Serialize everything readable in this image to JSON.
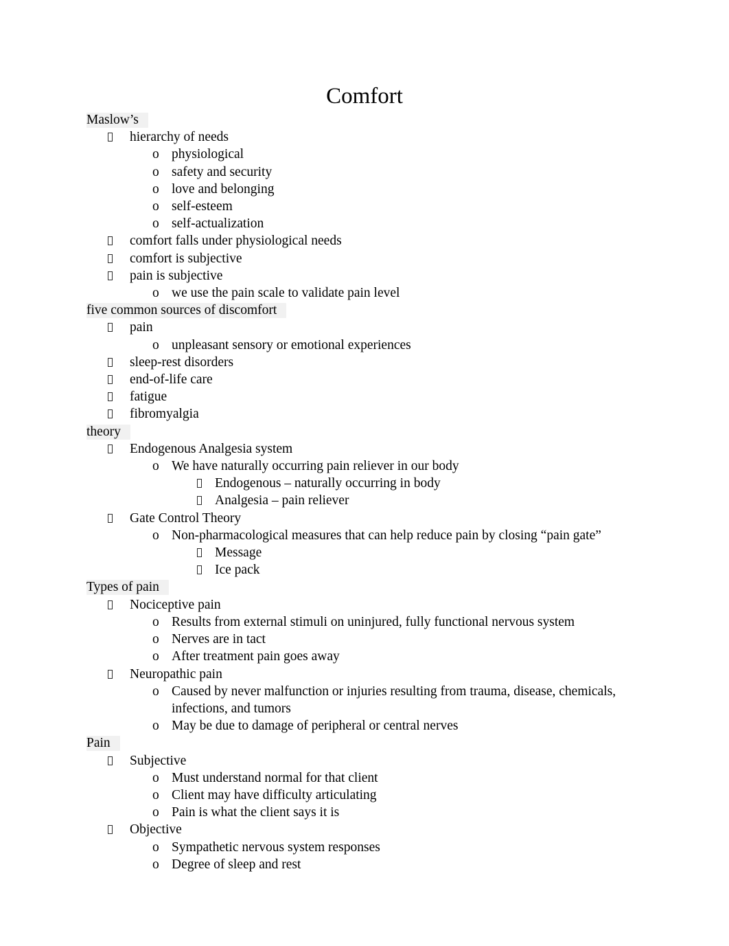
{
  "document": {
    "title": "Comfort",
    "page_background": "#ffffff",
    "text_color": "#000000",
    "heading_highlight_color": "#f1f1f1",
    "bullet_glyphs": {
      "level1": "missing-glyph-box",
      "level2": "o",
      "level3": "missing-glyph-box"
    }
  },
  "outline": [
    {
      "level": 0,
      "text": "Maslow’s",
      "shaded": true
    },
    {
      "level": 1,
      "text": "hierarchy of needs"
    },
    {
      "level": 2,
      "text": "physiological"
    },
    {
      "level": 2,
      "text": "safety and security"
    },
    {
      "level": 2,
      "text": "love and belonging"
    },
    {
      "level": 2,
      "text": "self-esteem"
    },
    {
      "level": 2,
      "text": "self-actualization"
    },
    {
      "level": 1,
      "text": "comfort falls under physiological needs"
    },
    {
      "level": 1,
      "text": "comfort is subjective"
    },
    {
      "level": 1,
      "text": "pain is subjective"
    },
    {
      "level": 2,
      "text": "we use the pain scale to validate pain level"
    },
    {
      "level": 0,
      "text": "five common sources of discomfort",
      "shaded": true
    },
    {
      "level": 1,
      "text": "pain"
    },
    {
      "level": 2,
      "text": "unpleasant sensory or emotional experiences"
    },
    {
      "level": 1,
      "text": "sleep-rest disorders"
    },
    {
      "level": 1,
      "text": "end-of-life care"
    },
    {
      "level": 1,
      "text": "fatigue"
    },
    {
      "level": 1,
      "text": "fibromyalgia"
    },
    {
      "level": 0,
      "text": "theory",
      "shaded": true
    },
    {
      "level": 1,
      "text": "Endogenous Analgesia system"
    },
    {
      "level": 2,
      "text": "We have naturally occurring pain reliever in our body"
    },
    {
      "level": 3,
      "text": "Endogenous – naturally occurring in body"
    },
    {
      "level": 3,
      "text": "Analgesia – pain reliever"
    },
    {
      "level": 1,
      "text": "Gate Control Theory"
    },
    {
      "level": 2,
      "text": "Non-pharmacological measures that can help reduce pain by closing “pain gate”"
    },
    {
      "level": 3,
      "text": "Message"
    },
    {
      "level": 3,
      "text": "Ice pack"
    },
    {
      "level": 0,
      "text": "Types of pain",
      "shaded": true
    },
    {
      "level": 1,
      "text": "Nociceptive pain"
    },
    {
      "level": 2,
      "text": "Results from external stimuli on uninjured, fully functional nervous system"
    },
    {
      "level": 2,
      "text": "Nerves are in tact"
    },
    {
      "level": 2,
      "text": "After treatment pain goes away"
    },
    {
      "level": 1,
      "text": "Neuropathic pain"
    },
    {
      "level": 2,
      "text": "Caused by never malfunction or injuries resulting from trauma, disease, chemicals, infections, and tumors",
      "wraps": true
    },
    {
      "level": 2,
      "text": "May be due to damage of peripheral or central nerves"
    },
    {
      "level": 0,
      "text": "Pain",
      "shaded": true
    },
    {
      "level": 1,
      "text": "Subjective"
    },
    {
      "level": 2,
      "text": "Must understand normal for that client"
    },
    {
      "level": 2,
      "text": "Client may have difficulty articulating"
    },
    {
      "level": 2,
      "text": "Pain is what the client says it is"
    },
    {
      "level": 1,
      "text": "Objective"
    },
    {
      "level": 2,
      "text": "Sympathetic nervous system responses"
    },
    {
      "level": 2,
      "text": "Degree of sleep and rest"
    }
  ]
}
